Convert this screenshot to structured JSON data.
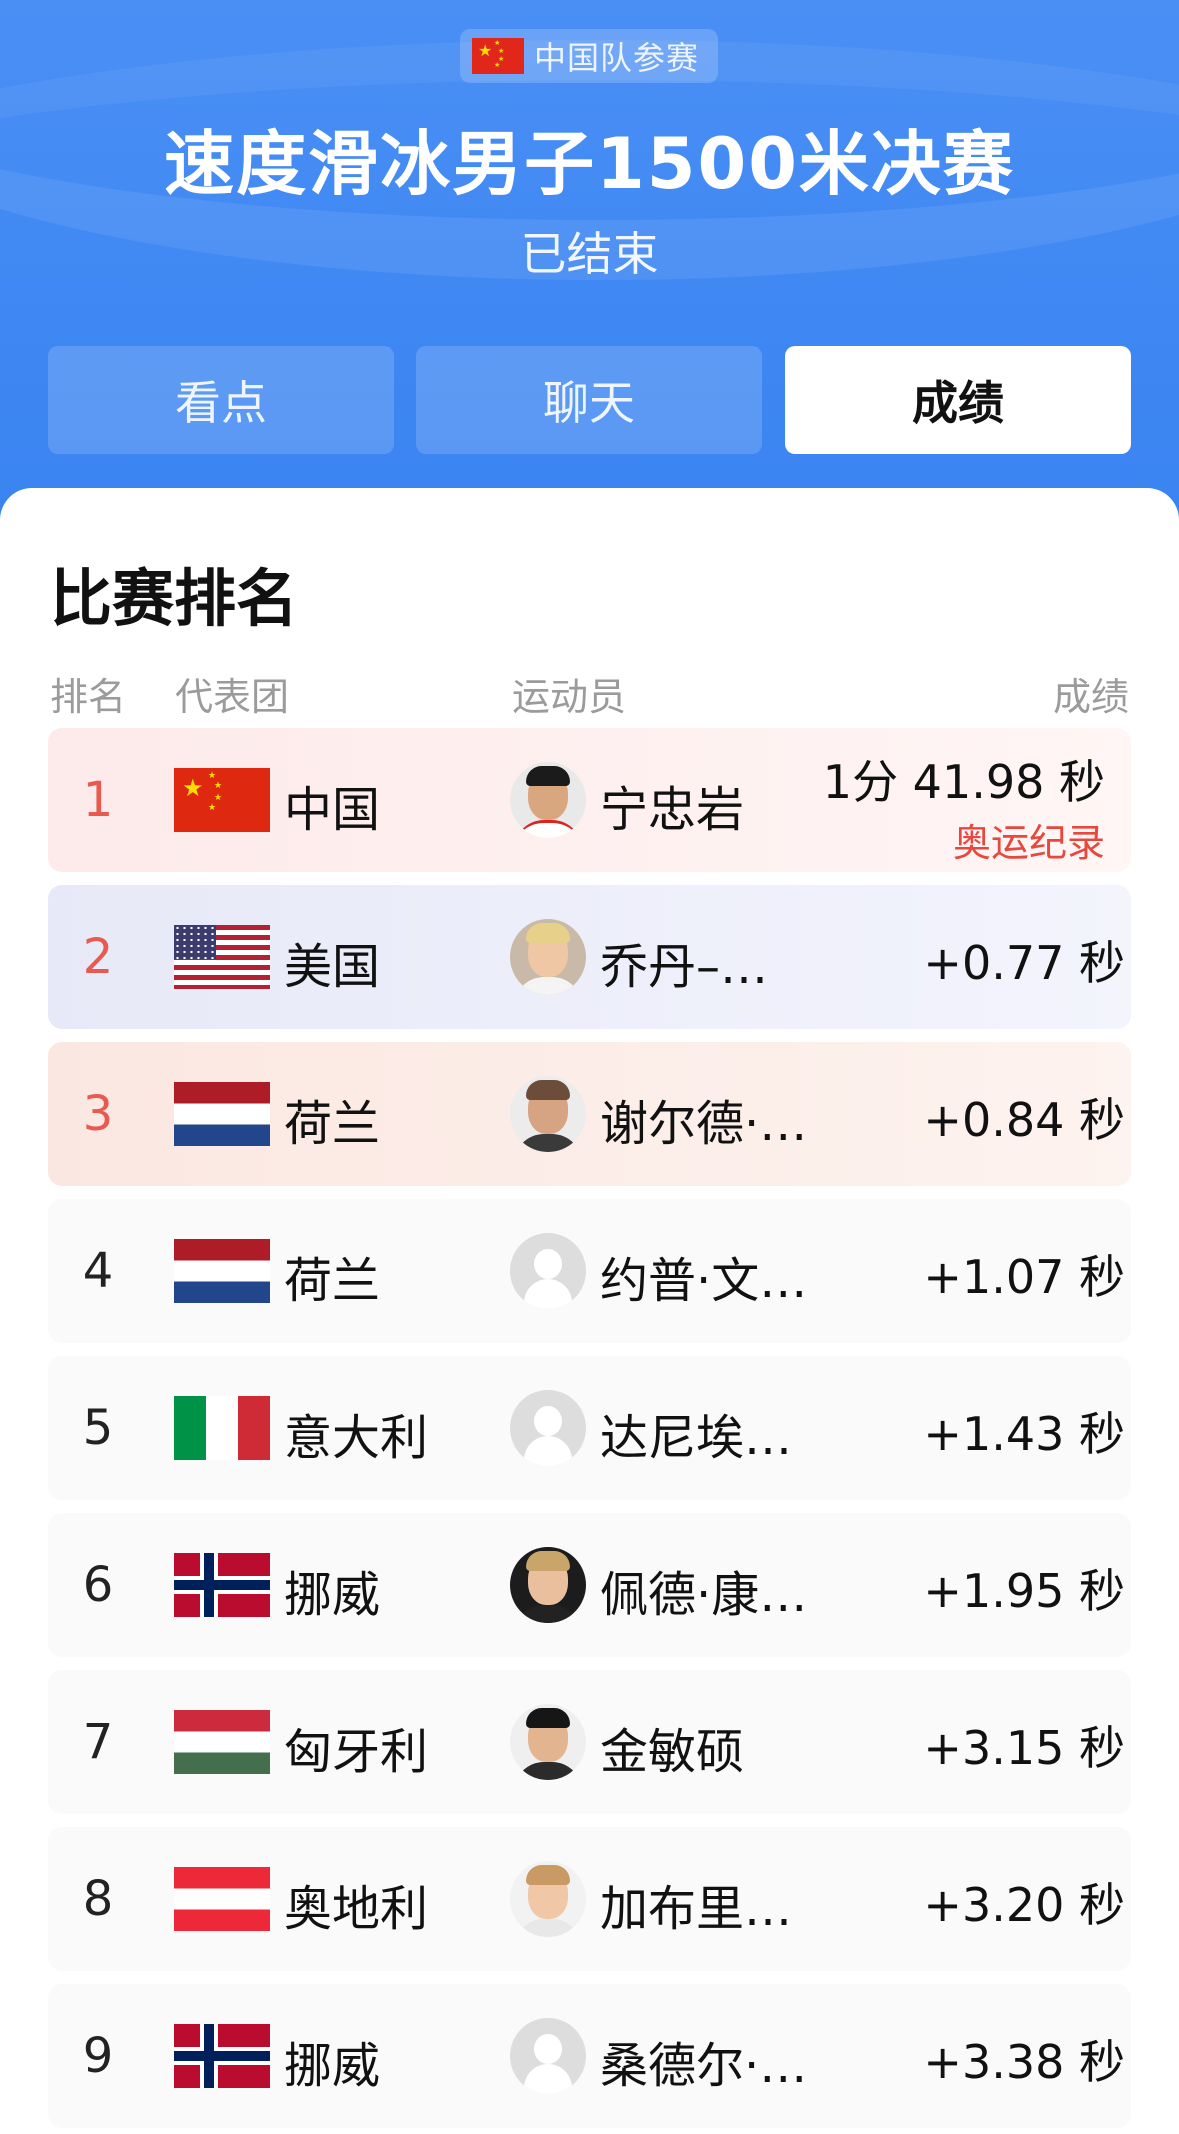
{
  "header": {
    "team_badge": "中国队参赛",
    "title": "速度滑冰男子1500米决赛",
    "status": "已结束"
  },
  "tabs": [
    {
      "label": "看点"
    },
    {
      "label": "聊天"
    },
    {
      "label": "成绩"
    }
  ],
  "section_title": "比赛排名",
  "columns": {
    "rank": "排名",
    "team": "代表团",
    "athlete": "运动员",
    "result": "成绩"
  },
  "rows": [
    {
      "rank": "1",
      "country": "中国",
      "athlete": "宁忠岩",
      "result": "1分 41.98 秒",
      "note": "奥运纪录",
      "flag": "cn-flag-icon"
    },
    {
      "rank": "2",
      "country": "美国",
      "athlete": "乔丹–…",
      "result": "+0.77 秒",
      "flag": "us-flag-icon"
    },
    {
      "rank": "3",
      "country": "荷兰",
      "athlete": "谢尔德·…",
      "result": "+0.84 秒",
      "flag": "nl-flag-icon"
    },
    {
      "rank": "4",
      "country": "荷兰",
      "athlete": "约普·文…",
      "result": "+1.07 秒",
      "flag": "nl-flag-icon"
    },
    {
      "rank": "5",
      "country": "意大利",
      "athlete": "达尼埃…",
      "result": "+1.43 秒",
      "flag": "it-flag-icon"
    },
    {
      "rank": "6",
      "country": "挪威",
      "athlete": "佩德·康…",
      "result": "+1.95 秒",
      "flag": "no-flag-icon"
    },
    {
      "rank": "7",
      "country": "匈牙利",
      "athlete": "金敏硕",
      "result": "+3.15 秒",
      "flag": "hu-flag-icon"
    },
    {
      "rank": "8",
      "country": "奥地利",
      "athlete": "加布里…",
      "result": "+3.20 秒",
      "flag": "at-flag-icon"
    },
    {
      "rank": "9",
      "country": "挪威",
      "athlete": "桑德尔·…",
      "result": "+3.38 秒",
      "flag": "no-flag-icon"
    }
  ],
  "colors": {
    "header_blue": "#3f88f3",
    "gold_row": "#fdeeee",
    "silver_row": "#eef0fb",
    "bronze_row": "#fcefe9",
    "record_red": "#e8473d",
    "rank_red": "#e85a4f"
  }
}
